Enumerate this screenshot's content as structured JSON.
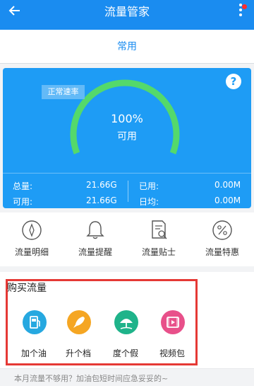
{
  "header": {
    "title": "流量管家",
    "back_icon": "arrow-left-icon",
    "menu_icon": "more-vertical-icon"
  },
  "tabs": [
    {
      "label": "常用"
    }
  ],
  "gauge": {
    "badge": "正常速率",
    "percent_text": "100%",
    "status": "可用",
    "level": 1.0,
    "help_label": "?"
  },
  "stats": {
    "total_label": "总量:",
    "total_value": "21.66G",
    "used_label": "已用:",
    "used_value": "0.00M",
    "available_label": "可用:",
    "available_value": "21.66G",
    "daily_label": "日均:",
    "daily_value": "0.00M"
  },
  "quick_actions": [
    {
      "label": "流量明细",
      "icon": "compass-icon"
    },
    {
      "label": "流量提醒",
      "icon": "bell-icon"
    },
    {
      "label": "流量贴士",
      "icon": "document-search-icon"
    },
    {
      "label": "流量特惠",
      "icon": "percent-icon"
    }
  ],
  "buy_section": {
    "title": "购买流量",
    "items": [
      {
        "label": "加个油",
        "icon": "fuel-pump-icon",
        "color": "#26a8e0"
      },
      {
        "label": "升个档",
        "icon": "rocket-icon",
        "color": "#f5a623"
      },
      {
        "label": "度个假",
        "icon": "beach-umbrella-icon",
        "color": "#1fb38a"
      },
      {
        "label": "视频包",
        "icon": "film-icon",
        "color": "#e8508a"
      }
    ]
  },
  "bottom_hint": "本月流量不够用？加油包短时间应急妥妥的~",
  "colors": {
    "primary": "#1a8cf0",
    "card": "#1e9cf5",
    "gauge_arc": "#54d96b",
    "highlight": "#e53935"
  }
}
